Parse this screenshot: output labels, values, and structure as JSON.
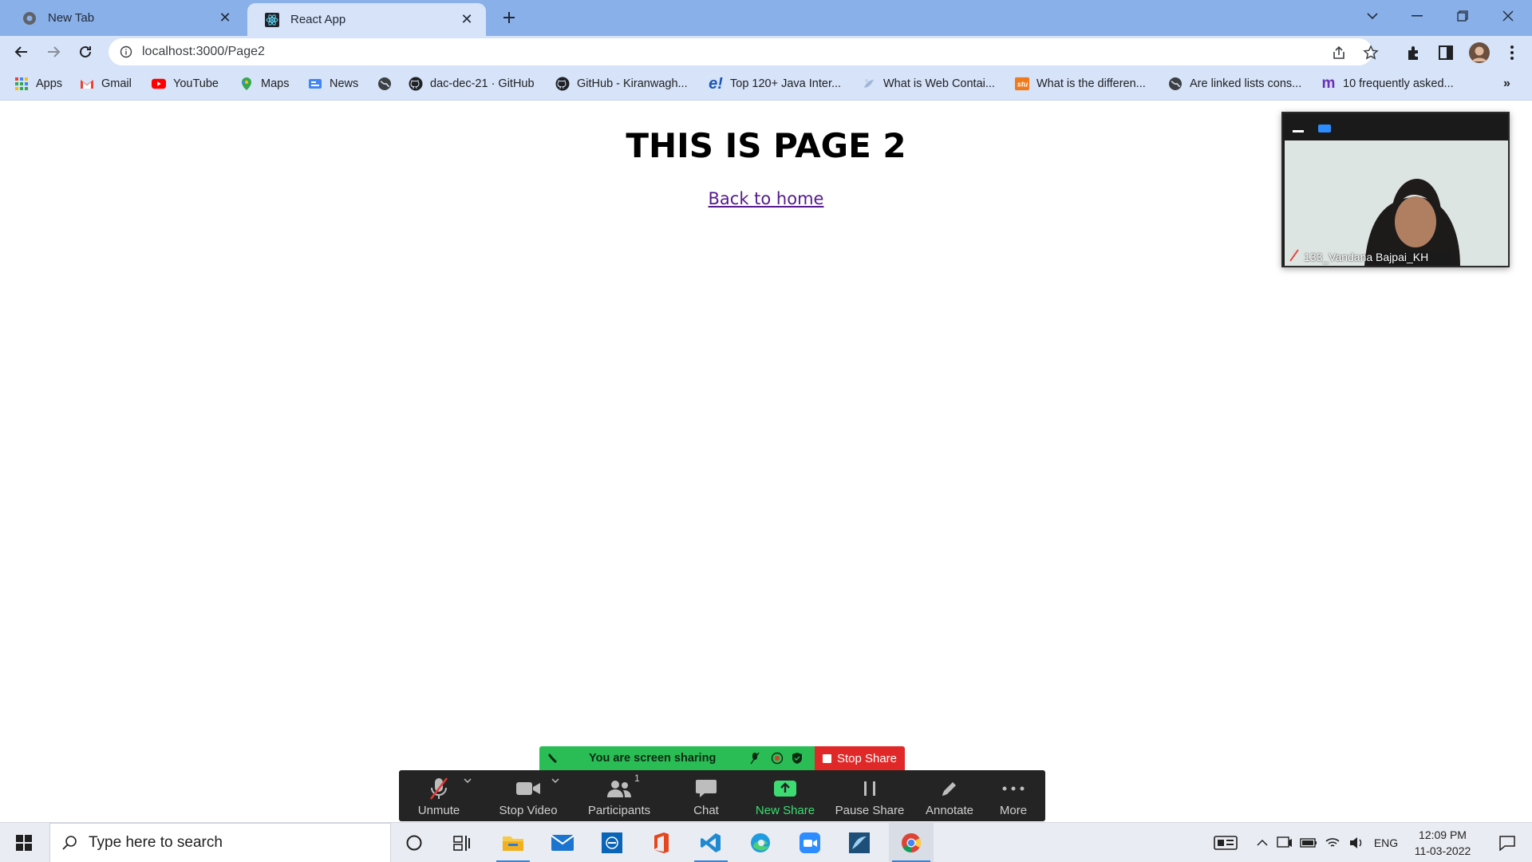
{
  "browser": {
    "tabs": [
      {
        "title": "New Tab",
        "active": false
      },
      {
        "title": "React App",
        "active": true
      }
    ],
    "url": "localhost:3000/Page2",
    "bookmarks": [
      {
        "label": "Apps",
        "icon": "apps-grid-icon"
      },
      {
        "label": "Gmail",
        "icon": "gmail-icon"
      },
      {
        "label": "YouTube",
        "icon": "youtube-icon"
      },
      {
        "label": "Maps",
        "icon": "maps-icon"
      },
      {
        "label": "News",
        "icon": "news-icon"
      },
      {
        "label": "",
        "icon": "globe-icon"
      },
      {
        "label": "dac-dec-21 · GitHub",
        "icon": "github-icon"
      },
      {
        "label": "GitHub - Kiranwagh...",
        "icon": "github-icon"
      },
      {
        "label": "Top 120+ Java Inter...",
        "icon": "edureka-icon"
      },
      {
        "label": "What is Web Contai...",
        "icon": "page-icon"
      },
      {
        "label": "What is the differen...",
        "icon": "site-icon"
      },
      {
        "label": "Are linked lists cons...",
        "icon": "globe-icon"
      },
      {
        "label": "10 frequently asked...",
        "icon": "medium-icon"
      }
    ]
  },
  "page": {
    "heading": "THIS IS PAGE 2",
    "link": "Back to home"
  },
  "zoom": {
    "participant_name": "133_Vandana Bajpai_KH",
    "sharing_text": "You are screen sharing",
    "stop_share": "Stop Share",
    "participants_count": "1",
    "controls": [
      {
        "label": "Unmute",
        "icon": "mic-muted-icon"
      },
      {
        "label": "Stop Video",
        "icon": "video-camera-icon"
      },
      {
        "label": "Participants",
        "icon": "participants-icon"
      },
      {
        "label": "Chat",
        "icon": "chat-icon"
      },
      {
        "label": "New Share",
        "icon": "share-screen-icon"
      },
      {
        "label": "Pause Share",
        "icon": "pause-icon"
      },
      {
        "label": "Annotate",
        "icon": "pencil-icon"
      },
      {
        "label": "More",
        "icon": "more-dots-icon"
      }
    ]
  },
  "taskbar": {
    "search_placeholder": "Type here to search",
    "language": "ENG",
    "time": "12:09 PM",
    "date": "11-03-2022"
  },
  "colors": {
    "tabstrip": "#8ab0e9",
    "toolbar": "#d6e3f8",
    "link_visited": "#551a8b",
    "zoom_green": "#2bbd55",
    "zoom_red": "#e02828",
    "zoom_bar": "#242424"
  }
}
